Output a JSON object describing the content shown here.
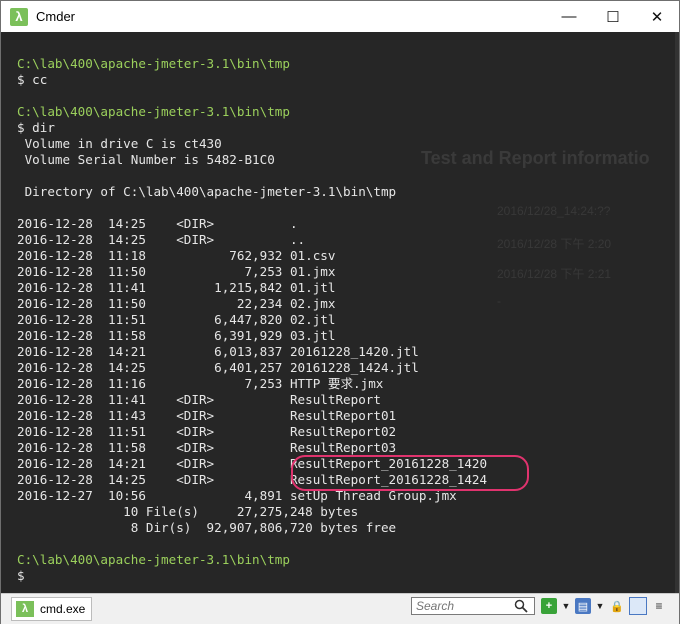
{
  "window": {
    "title": "Cmder",
    "app_icon": "λ",
    "controls": {
      "minimize": "—",
      "maximize": "☐",
      "close": "✕"
    }
  },
  "background_ghost": {
    "title": "Test and Report informatio",
    "lines": [
      "2016/12/28_14:24:??",
      "2016/12/28 下午 2:20",
      "2016/12/28 下午 2:21",
      "-"
    ]
  },
  "terminal": {
    "lines": [
      {
        "path": "C:\\lab\\400\\apache-jmeter-3.1\\bin\\tmp",
        "text": ""
      },
      {
        "path": "",
        "text": "$ cc"
      },
      {
        "path": "",
        "text": ""
      },
      {
        "path": "C:\\lab\\400\\apache-jmeter-3.1\\bin\\tmp",
        "text": ""
      },
      {
        "path": "",
        "text": "$ dir"
      },
      {
        "path": "",
        "text": " Volume in drive C is ct430"
      },
      {
        "path": "",
        "text": " Volume Serial Number is 5482-B1C0"
      },
      {
        "path": "",
        "text": ""
      },
      {
        "path": "",
        "text": " Directory of C:\\lab\\400\\apache-jmeter-3.1\\bin\\tmp"
      },
      {
        "path": "",
        "text": ""
      },
      {
        "path": "",
        "text": "2016-12-28  14:25    <DIR>          ."
      },
      {
        "path": "",
        "text": "2016-12-28  14:25    <DIR>          .."
      },
      {
        "path": "",
        "text": "2016-12-28  11:18           762,932 01.csv"
      },
      {
        "path": "",
        "text": "2016-12-28  11:50             7,253 01.jmx"
      },
      {
        "path": "",
        "text": "2016-12-28  11:41         1,215,842 01.jtl"
      },
      {
        "path": "",
        "text": "2016-12-28  11:50            22,234 02.jmx"
      },
      {
        "path": "",
        "text": "2016-12-28  11:51         6,447,820 02.jtl"
      },
      {
        "path": "",
        "text": "2016-12-28  11:58         6,391,929 03.jtl"
      },
      {
        "path": "",
        "text": "2016-12-28  14:21         6,013,837 20161228_1420.jtl"
      },
      {
        "path": "",
        "text": "2016-12-28  14:25         6,401,257 20161228_1424.jtl"
      },
      {
        "path": "",
        "text": "2016-12-28  11:16             7,253 HTTP 要求.jmx"
      },
      {
        "path": "",
        "text": "2016-12-28  11:41    <DIR>          ResultReport"
      },
      {
        "path": "",
        "text": "2016-12-28  11:43    <DIR>          ResultReport01"
      },
      {
        "path": "",
        "text": "2016-12-28  11:51    <DIR>          ResultReport02"
      },
      {
        "path": "",
        "text": "2016-12-28  11:58    <DIR>          ResultReport03"
      },
      {
        "path": "",
        "text": "2016-12-28  14:21    <DIR>          ResultReport_20161228_1420"
      },
      {
        "path": "",
        "text": "2016-12-28  14:25    <DIR>          ResultReport_20161228_1424"
      },
      {
        "path": "",
        "text": "2016-12-27  10:56             4,891 setUp Thread Group.jmx"
      },
      {
        "path": "",
        "text": "              10 File(s)     27,275,248 bytes"
      },
      {
        "path": "",
        "text": "               8 Dir(s)  92,907,806,720 bytes free"
      },
      {
        "path": "",
        "text": ""
      },
      {
        "path": "C:\\lab\\400\\apache-jmeter-3.1\\bin\\tmp",
        "text": ""
      },
      {
        "path": "",
        "text": "$"
      }
    ],
    "highlight_color": "#e0336e"
  },
  "statusbar": {
    "tab_icon": "λ",
    "tab_label": "cmd.exe",
    "search_placeholder": "Search",
    "tools": {
      "add": "+",
      "dropdown": "▼",
      "list": "▤",
      "lock": "🔒",
      "menu": "≡"
    }
  },
  "colors": {
    "path": "#9bd05c",
    "background": "#262626",
    "text": "#e6e6e6"
  }
}
